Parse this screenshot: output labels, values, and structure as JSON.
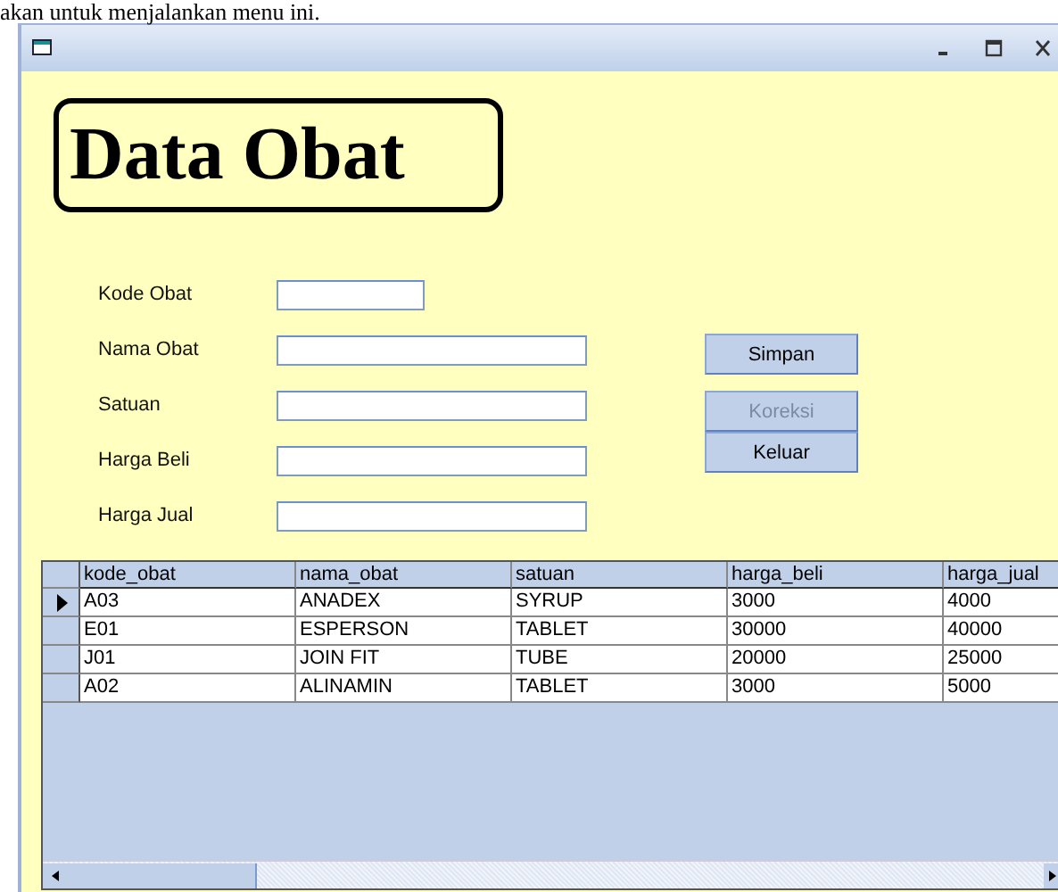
{
  "caption": "akan untuk menjalankan menu ini.",
  "heading": "Data Obat",
  "fields": [
    {
      "label": "Kode Obat"
    },
    {
      "label": "Nama Obat"
    },
    {
      "label": "Satuan"
    },
    {
      "label": "Harga Beli"
    },
    {
      "label": "Harga Jual"
    }
  ],
  "buttons": [
    {
      "label": "Simpan",
      "disabled": false
    },
    {
      "label": "Koreksi",
      "disabled": true
    },
    {
      "label": "Keluar",
      "disabled": false
    }
  ],
  "table": {
    "columns": [
      "kode_obat",
      "nama_obat",
      "satuan",
      "harga_beli",
      "harga_jual"
    ],
    "rows": [
      {
        "selected": true,
        "cells": [
          "A03",
          "ANADEX",
          "SYRUP",
          "3000",
          "4000"
        ]
      },
      {
        "selected": false,
        "cells": [
          "E01",
          "ESPERSON",
          "TABLET",
          "30000",
          "40000"
        ]
      },
      {
        "selected": false,
        "cells": [
          "J01",
          "JOIN FIT",
          "TUBE",
          "20000",
          "25000"
        ]
      },
      {
        "selected": false,
        "cells": [
          "A02",
          "ALINAMIN",
          "TABLET",
          "3000",
          "5000"
        ]
      }
    ]
  }
}
